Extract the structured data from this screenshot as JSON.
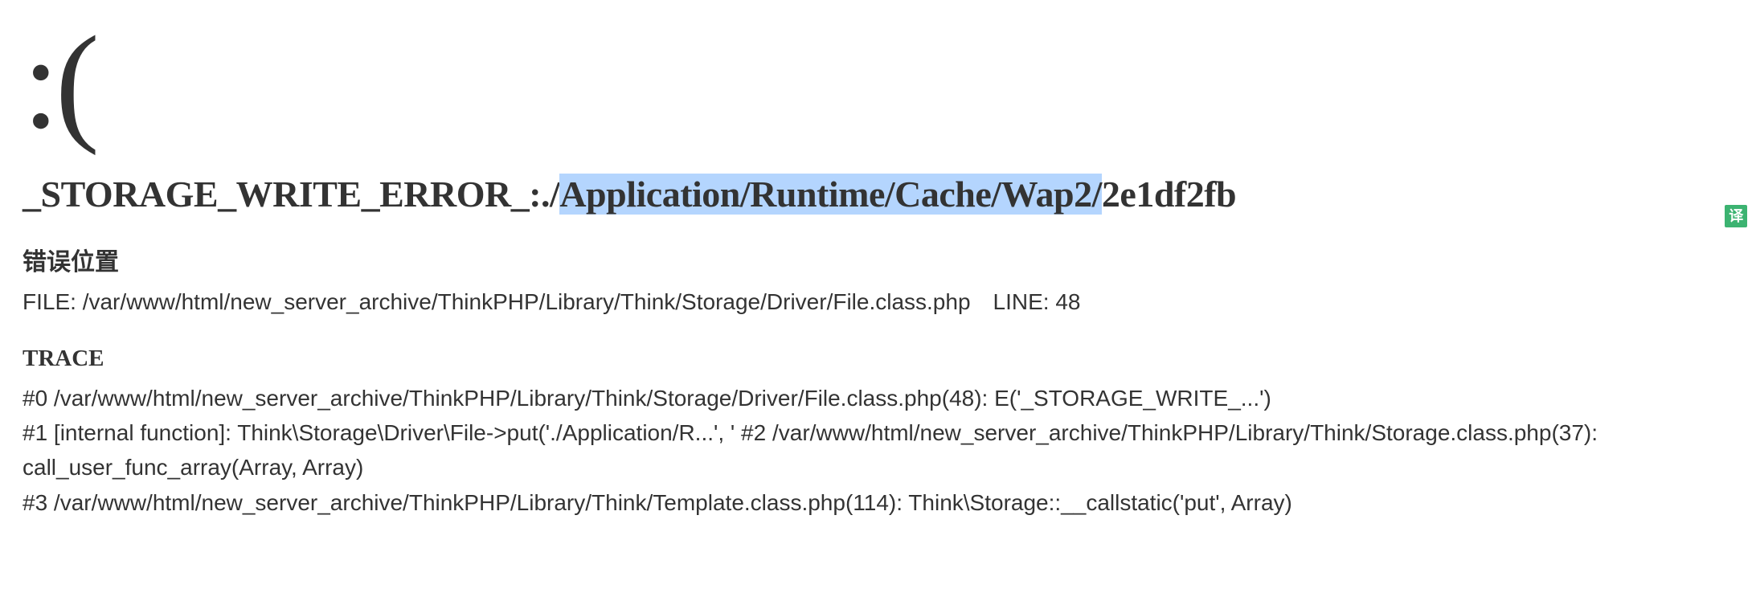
{
  "sad_face": ":(",
  "error": {
    "prefix": "_STORAGE_WRITE_ERROR_:./",
    "highlighted": "Application/Runtime/Cache/Wap2/",
    "suffix": "2e1df2fb"
  },
  "translate_badge": "译",
  "location": {
    "heading": "错误位置",
    "file_label": "FILE: ",
    "file_path": "/var/www/html/new_server_archive/ThinkPHP/Library/Think/Storage/Driver/File.class.php",
    "line_label": "LINE: ",
    "line_number": "48"
  },
  "trace": {
    "heading": "TRACE",
    "lines": [
      "#0 /var/www/html/new_server_archive/ThinkPHP/Library/Think/Storage/Driver/File.class.php(48): E('_STORAGE_WRITE_...')",
      "#1 [internal function]: Think\\Storage\\Driver\\File->put('./Application/R...', ' #2 /var/www/html/new_server_archive/ThinkPHP/Library/Think/Storage.class.php(37): call_user_func_array(Array, Array)",
      "#3 /var/www/html/new_server_archive/ThinkPHP/Library/Think/Template.class.php(114): Think\\Storage::__callstatic('put', Array)"
    ]
  }
}
